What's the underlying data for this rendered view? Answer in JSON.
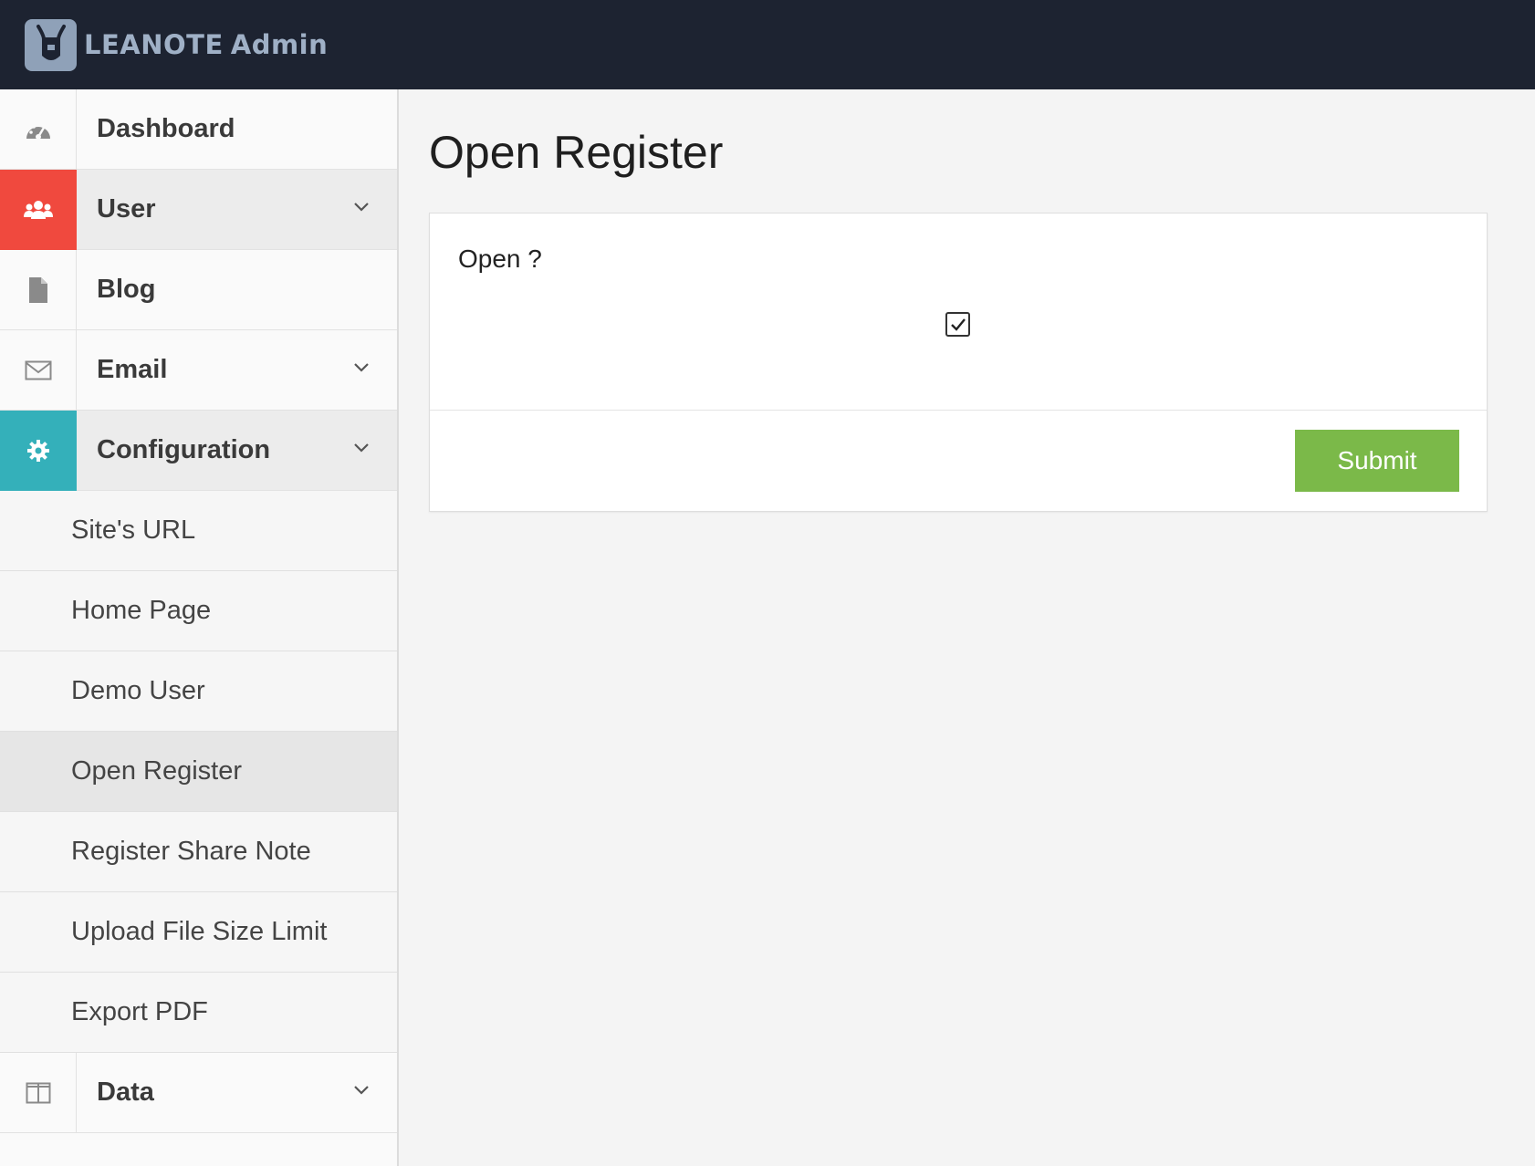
{
  "header": {
    "brand": "LEANOTE",
    "admin_label": "Admin"
  },
  "sidebar": {
    "items": [
      {
        "label": "Dashboard",
        "icon": "dashboard-icon"
      },
      {
        "label": "User",
        "icon": "users-icon",
        "color": "#f0493e"
      },
      {
        "label": "Blog",
        "icon": "file-icon"
      },
      {
        "label": "Email",
        "icon": "envelope-icon"
      },
      {
        "label": "Configuration",
        "icon": "gear-icon",
        "color": "#34b0ba"
      },
      {
        "label": "Data",
        "icon": "columns-icon"
      }
    ],
    "config_subitems": [
      "Site's URL",
      "Home Page",
      "Demo User",
      "Open Register",
      "Register Share Note",
      "Upload File Size Limit",
      "Export PDF"
    ],
    "active_subitem": "Open Register"
  },
  "main": {
    "title": "Open Register",
    "field_label": "Open ?",
    "checkbox_checked": true,
    "submit_label": "Submit",
    "submit_color": "#7bb949"
  }
}
